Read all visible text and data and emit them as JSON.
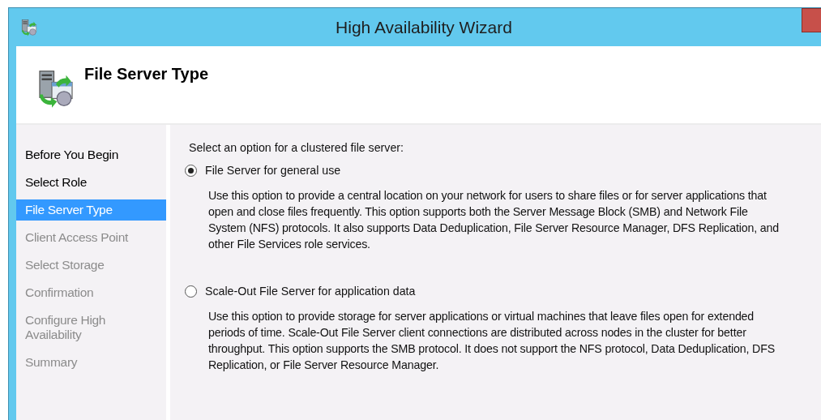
{
  "window": {
    "title": "High Availability Wizard"
  },
  "header": {
    "title": "File Server Type"
  },
  "steps": [
    {
      "label": "Before You Begin",
      "selected": false,
      "enabled": true
    },
    {
      "label": "Select Role",
      "selected": false,
      "enabled": true
    },
    {
      "label": "File Server Type",
      "selected": true,
      "enabled": true
    },
    {
      "label": "Client Access Point",
      "selected": false,
      "enabled": false
    },
    {
      "label": "Select Storage",
      "selected": false,
      "enabled": false
    },
    {
      "label": "Confirmation",
      "selected": false,
      "enabled": false
    },
    {
      "label": "Configure High Availability",
      "selected": false,
      "enabled": false
    },
    {
      "label": "Summary",
      "selected": false,
      "enabled": false
    }
  ],
  "prompt": "Select an option for a clustered file server:",
  "options": [
    {
      "label": "File Server for general use",
      "selected": true,
      "description": "Use this option to provide a central location on your network for users to share files or for server applications that open and close files frequently. This option supports both the Server Message Block (SMB) and Network File System (NFS) protocols. It also supports Data Deduplication, File Server Resource Manager, DFS Replication, and other File Services role services."
    },
    {
      "label": "Scale-Out File Server for application data",
      "selected": false,
      "description": "Use this option to provide storage for server applications or virtual machines that leave files open for extended periods of time. Scale-Out File Server client connections are distributed across nodes in the cluster for better throughput. This option supports the SMB protocol. It does not support the NFS protocol, Data Deduplication, DFS Replication, or File Server Resource Manager."
    }
  ]
}
